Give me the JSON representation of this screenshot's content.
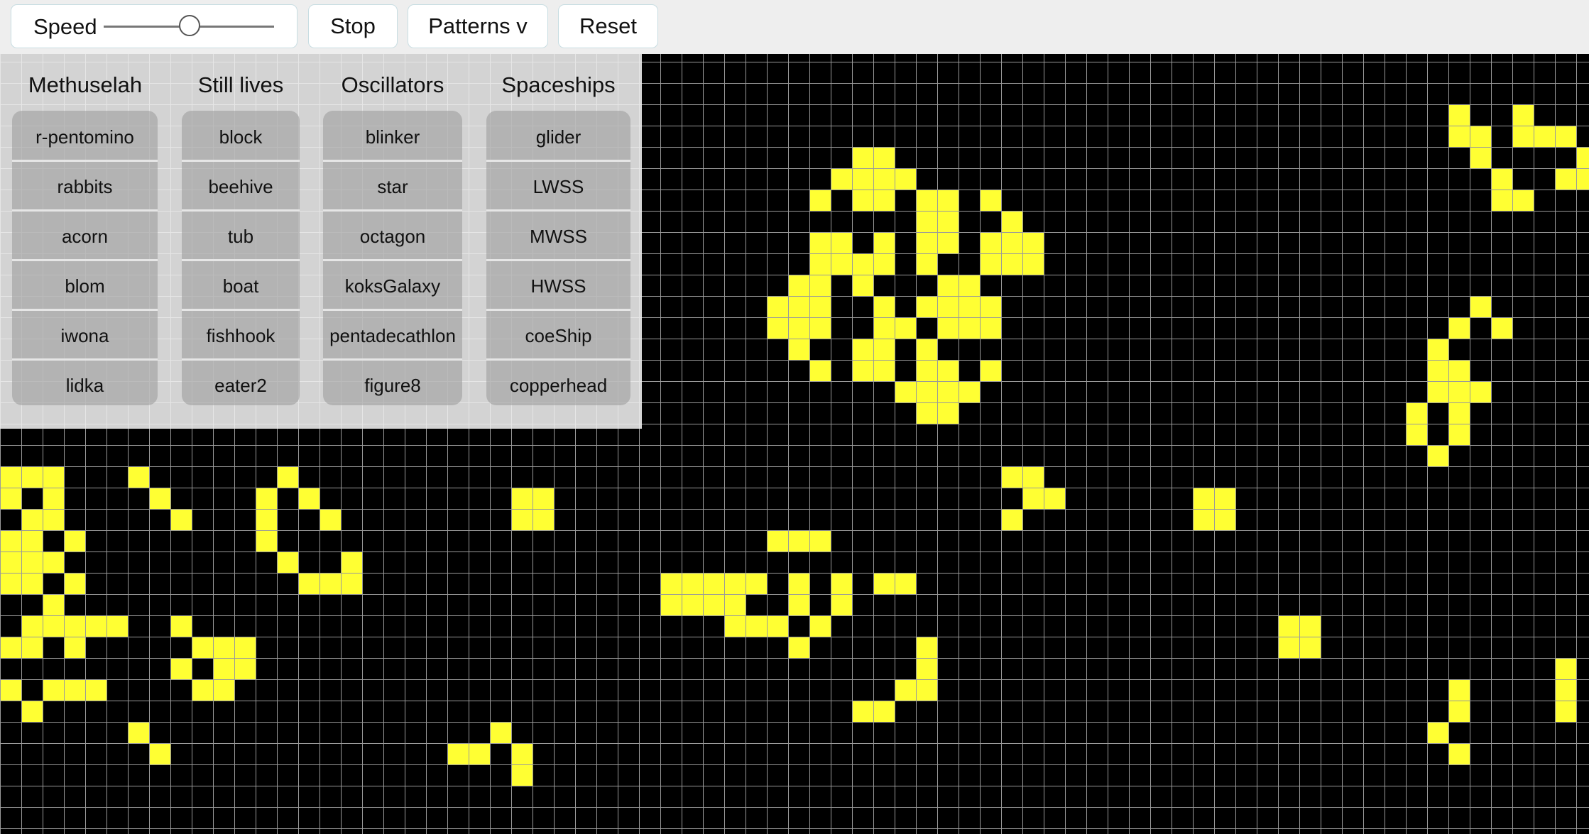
{
  "toolbar": {
    "speed_label": "Speed",
    "speed_value": 0.5,
    "stop_label": "Stop",
    "patterns_label": "Patterns v",
    "reset_label": "Reset"
  },
  "colors": {
    "board_background": "#000000",
    "grid_line": "#9a9a9a",
    "live_cell": "#ffff33"
  },
  "patterns": {
    "columns": [
      {
        "title": "Methuselah",
        "items": [
          "r-pentomino",
          "rabbits",
          "acorn",
          "blom",
          "iwona",
          "lidka"
        ]
      },
      {
        "title": "Still lives",
        "items": [
          "block",
          "beehive",
          "tub",
          "boat",
          "fishhook",
          "eater2"
        ]
      },
      {
        "title": "Oscillators",
        "items": [
          "blinker",
          "star",
          "octagon",
          "koksGalaxy",
          "pentadecathlon",
          "figure8"
        ]
      },
      {
        "title": "Spaceships",
        "items": [
          "glider",
          "LWSS",
          "MWSS",
          "HWSS",
          "coeShip",
          "copperhead"
        ]
      }
    ]
  }
}
